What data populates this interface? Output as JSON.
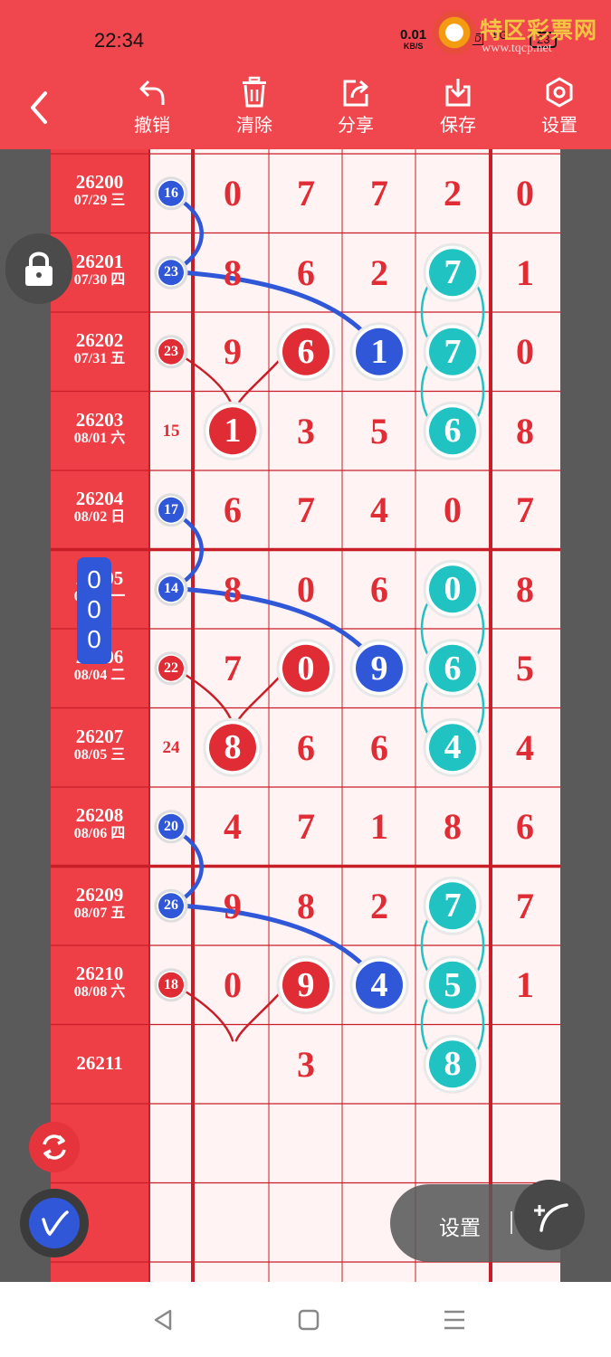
{
  "status_bar": {
    "time": "22:34",
    "speed_value": "0.01",
    "speed_unit": "KB/S",
    "hd": "HD",
    "network": "5G",
    "battery": "23"
  },
  "brand": {
    "title": "特区彩票网",
    "url": "www.tqcp.net",
    "logo": "tqcp-logo"
  },
  "toolbar": {
    "back_icon": "chevron-left-icon",
    "items": [
      {
        "label": "撤销",
        "icon": "undo-icon"
      },
      {
        "label": "清除",
        "icon": "trash-icon"
      },
      {
        "label": "分享",
        "icon": "share-icon"
      },
      {
        "label": "保存",
        "icon": "download-icon"
      },
      {
        "label": "设置",
        "icon": "settings-icon"
      }
    ]
  },
  "colors": {
    "header_red": "#f0474e",
    "label_red": "#ee3f47",
    "digit_red": "#e02c34",
    "grid_red": "#c81e28",
    "ball_blue": "#2f57d8",
    "ball_teal": "#21c2c2"
  },
  "rows": [
    {
      "issue": "26200",
      "date": "07/29 三",
      "sum": "16",
      "sum_style": "blue",
      "digits": [
        "0",
        "7",
        "7",
        "2",
        "0"
      ]
    },
    {
      "issue": "26201",
      "date": "07/30 四",
      "sum": "23",
      "sum_style": "blue",
      "digits": [
        "8",
        "6",
        "2",
        "7",
        "1"
      ]
    },
    {
      "issue": "26202",
      "date": "07/31 五",
      "sum": "23",
      "sum_style": "red",
      "digits": [
        "9",
        "6",
        "1",
        "7",
        "0"
      ]
    },
    {
      "issue": "26203",
      "date": "08/01 六",
      "sum": "15",
      "sum_style": "plain",
      "digits": [
        "1",
        "3",
        "5",
        "6",
        "8"
      ]
    },
    {
      "issue": "26204",
      "date": "08/02 日",
      "sum": "17",
      "sum_style": "blue",
      "digits": [
        "6",
        "7",
        "4",
        "0",
        "7"
      ]
    },
    {
      "issue": "26205",
      "date": "08/03 一",
      "sum": "14",
      "sum_style": "blue",
      "digits": [
        "8",
        "0",
        "6",
        "0",
        "8"
      ]
    },
    {
      "issue": "26206",
      "date": "08/04 二",
      "sum": "22",
      "sum_style": "red",
      "digits": [
        "7",
        "0",
        "9",
        "6",
        "5"
      ]
    },
    {
      "issue": "26207",
      "date": "08/05 三",
      "sum": "24",
      "sum_style": "plain",
      "digits": [
        "8",
        "6",
        "6",
        "4",
        "4"
      ]
    },
    {
      "issue": "26208",
      "date": "08/06 四",
      "sum": "20",
      "sum_style": "blue",
      "digits": [
        "4",
        "7",
        "1",
        "8",
        "6"
      ]
    },
    {
      "issue": "26209",
      "date": "08/07 五",
      "sum": "26",
      "sum_style": "blue",
      "digits": [
        "9",
        "8",
        "2",
        "7",
        "7"
      ]
    },
    {
      "issue": "26210",
      "date": "08/08 六",
      "sum": "18",
      "sum_style": "red",
      "digits": [
        "0",
        "9",
        "4",
        "5",
        "1"
      ]
    },
    {
      "issue": "26211",
      "date": "",
      "sum": "",
      "sum_style": "plain",
      "digits": [
        "",
        "3",
        "",
        "8",
        ""
      ]
    }
  ],
  "highlights": [
    {
      "row": 1,
      "col": 3,
      "style": "teal"
    },
    {
      "row": 2,
      "col": 1,
      "style": "red"
    },
    {
      "row": 2,
      "col": 2,
      "style": "blue"
    },
    {
      "row": 2,
      "col": 3,
      "style": "teal"
    },
    {
      "row": 3,
      "col": 0,
      "style": "red"
    },
    {
      "row": 3,
      "col": 3,
      "style": "teal"
    },
    {
      "row": 5,
      "col": 3,
      "style": "teal"
    },
    {
      "row": 6,
      "col": 1,
      "style": "red"
    },
    {
      "row": 6,
      "col": 2,
      "style": "blue"
    },
    {
      "row": 6,
      "col": 3,
      "style": "teal"
    },
    {
      "row": 7,
      "col": 0,
      "style": "red"
    },
    {
      "row": 7,
      "col": 3,
      "style": "teal"
    },
    {
      "row": 9,
      "col": 3,
      "style": "teal"
    },
    {
      "row": 10,
      "col": 1,
      "style": "red"
    },
    {
      "row": 10,
      "col": 2,
      "style": "blue"
    },
    {
      "row": 10,
      "col": 3,
      "style": "teal"
    },
    {
      "row": 11,
      "col": 0,
      "style": "red"
    },
    {
      "row": 11,
      "col": 3,
      "style": "teal"
    }
  ],
  "floating": {
    "lock_icon": "lock-icon",
    "indicator_digits": [
      "0",
      "0",
      "0"
    ],
    "refresh_icon": "refresh-icon",
    "pen_icon": "pen-icon",
    "settings_label": "设置",
    "line_tool_icon": "curve-tool-icon"
  },
  "navbar": {
    "back": "nav-back-icon",
    "home": "nav-home-icon",
    "menu": "nav-menu-icon"
  }
}
